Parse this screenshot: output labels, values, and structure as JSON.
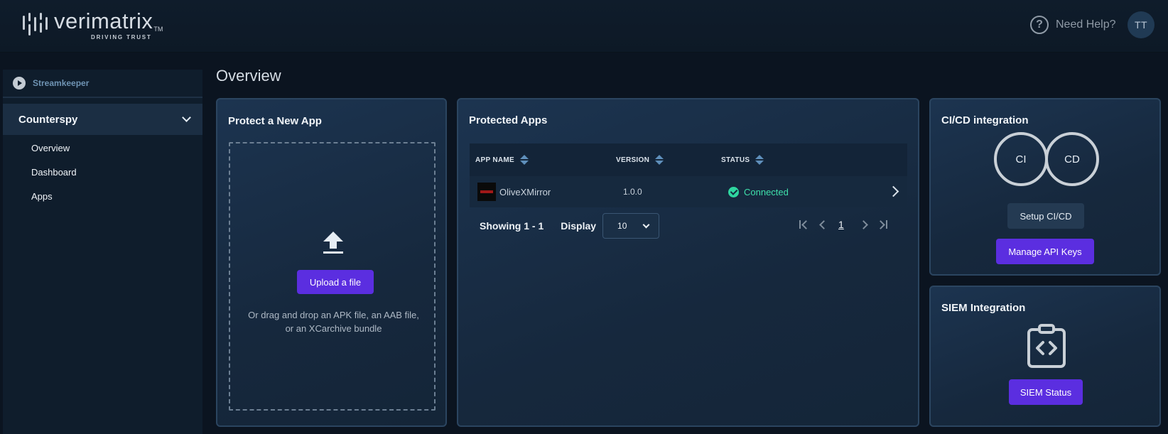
{
  "header": {
    "logo_word": "verimatrix",
    "logo_tm": "TM",
    "logo_tagline": "DRIVING TRUST",
    "help_label": "Need Help?",
    "avatar_initials": "TT"
  },
  "sidebar": {
    "product": "Streamkeeper",
    "group": "Counterspy",
    "items": [
      {
        "label": "Overview"
      },
      {
        "label": "Dashboard"
      },
      {
        "label": "Apps"
      }
    ]
  },
  "page": {
    "title": "Overview"
  },
  "protect_card": {
    "title": "Protect a New App",
    "upload_label": "Upload a file",
    "hint_line1": "Or drag and drop an APK file, an AAB file,",
    "hint_line2": "or an XCarchive bundle"
  },
  "apps_card": {
    "title": "Protected Apps",
    "columns": {
      "name": "APP NAME",
      "version": "VERSION",
      "status": "STATUS"
    },
    "rows": [
      {
        "name": "OliveXMirror",
        "version": "1.0.0",
        "status": "Connected"
      }
    ],
    "showing": "Showing 1 - 1",
    "display_label": "Display",
    "display_value": "10",
    "current_page": "1"
  },
  "cicd_card": {
    "title": "CI/CD integration",
    "ring_ci": "CI",
    "ring_cd": "CD",
    "setup_label": "Setup CI/CD",
    "api_label": "Manage API Keys"
  },
  "siem_card": {
    "title": "SIEM Integration",
    "status_label": "SIEM Status"
  },
  "colors": {
    "accent": "#5b2ee0",
    "status_connected": "#3fe0ab",
    "background": "#0b1420"
  },
  "icons": [
    "logo-mark-icon",
    "help-icon",
    "play-icon",
    "chevron-down-icon",
    "upload-icon",
    "sort-icon",
    "check-circle-icon",
    "chevron-right-icon",
    "first-page-icon",
    "prev-page-icon",
    "next-page-icon",
    "last-page-icon",
    "code-clipboard-icon"
  ]
}
